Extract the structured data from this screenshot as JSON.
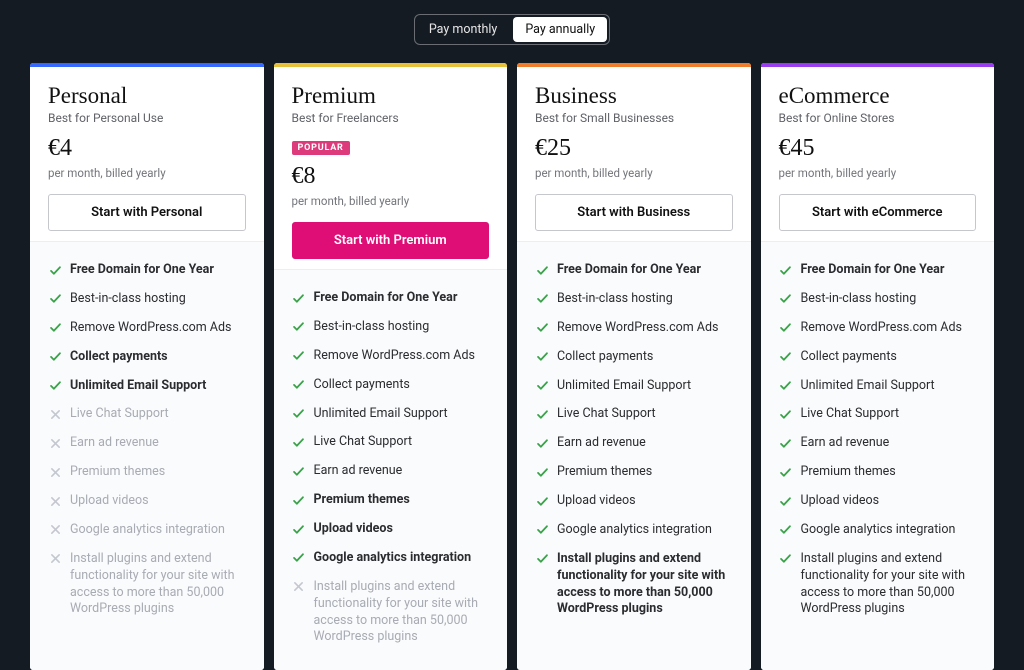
{
  "toggle": {
    "monthly": "Pay monthly",
    "annually": "Pay annually"
  },
  "features_master": [
    "Free Domain for One Year",
    "Best-in-class hosting",
    "Remove WordPress.com Ads",
    "Collect payments",
    "Unlimited Email Support",
    "Live Chat Support",
    "Earn ad revenue",
    "Premium themes",
    "Upload videos",
    "Google analytics integration",
    "Install plugins and extend functionality for your site with access to more than 50,000 WordPress plugins"
  ],
  "popular_label": "POPULAR",
  "billing_note": "per month, billed yearly",
  "plans": [
    {
      "name": "Personal",
      "tagline": "Best for Personal Use",
      "price": "€4",
      "cta": "Start with Personal",
      "accent": "#3769ff",
      "popular": false,
      "primary": false,
      "bold_idx": [
        0,
        3,
        4
      ],
      "included_upto": 4
    },
    {
      "name": "Premium",
      "tagline": "Best for Freelancers",
      "price": "€8",
      "cta": "Start with Premium",
      "accent": "#e8c13a",
      "popular": true,
      "primary": true,
      "bold_idx": [
        0,
        7,
        8,
        9
      ],
      "included_upto": 9
    },
    {
      "name": "Business",
      "tagline": "Best for Small Businesses",
      "price": "€25",
      "cta": "Start with Business",
      "accent": "#f07d2b",
      "popular": false,
      "primary": false,
      "bold_idx": [
        0,
        10
      ],
      "included_upto": 10
    },
    {
      "name": "eCommerce",
      "tagline": "Best for Online Stores",
      "price": "€45",
      "cta": "Start with eCommerce",
      "accent": "#9a3cf0",
      "popular": false,
      "primary": false,
      "bold_idx": [
        0
      ],
      "included_upto": 10
    }
  ]
}
